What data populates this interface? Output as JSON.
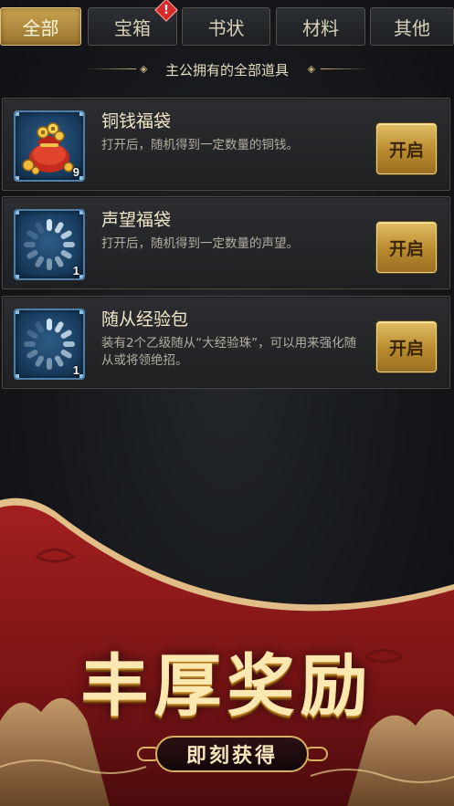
{
  "tabs": [
    {
      "label": "全部",
      "active": true
    },
    {
      "label": "宝箱",
      "badge": "!"
    },
    {
      "label": "书状"
    },
    {
      "label": "材料"
    },
    {
      "label": "其他"
    }
  ],
  "section_title": "主公拥有的全部道具",
  "items": [
    {
      "name": "铜钱福袋",
      "desc": "打开后，随机得到一定数量的铜钱。",
      "count": "9",
      "button": "开启",
      "icon": "coin-bag-icon"
    },
    {
      "name": "声望福袋",
      "desc": "打开后，随机得到一定数量的声望。",
      "count": "1",
      "button": "开启",
      "icon": "loading-spinner-icon"
    },
    {
      "name": "随从经验包",
      "desc": "装有2个乙级随从“大经验珠”，可以用来强化随从或将领绝招。",
      "count": "1",
      "button": "开启",
      "icon": "loading-spinner-icon"
    }
  ],
  "promo": {
    "title": "丰厚奖励",
    "subtitle": "即刻获得"
  },
  "colors": {
    "gold_accent": "#c9a34f",
    "banner_red": "#8e1a1c",
    "card_bg": "#2b2d30"
  }
}
